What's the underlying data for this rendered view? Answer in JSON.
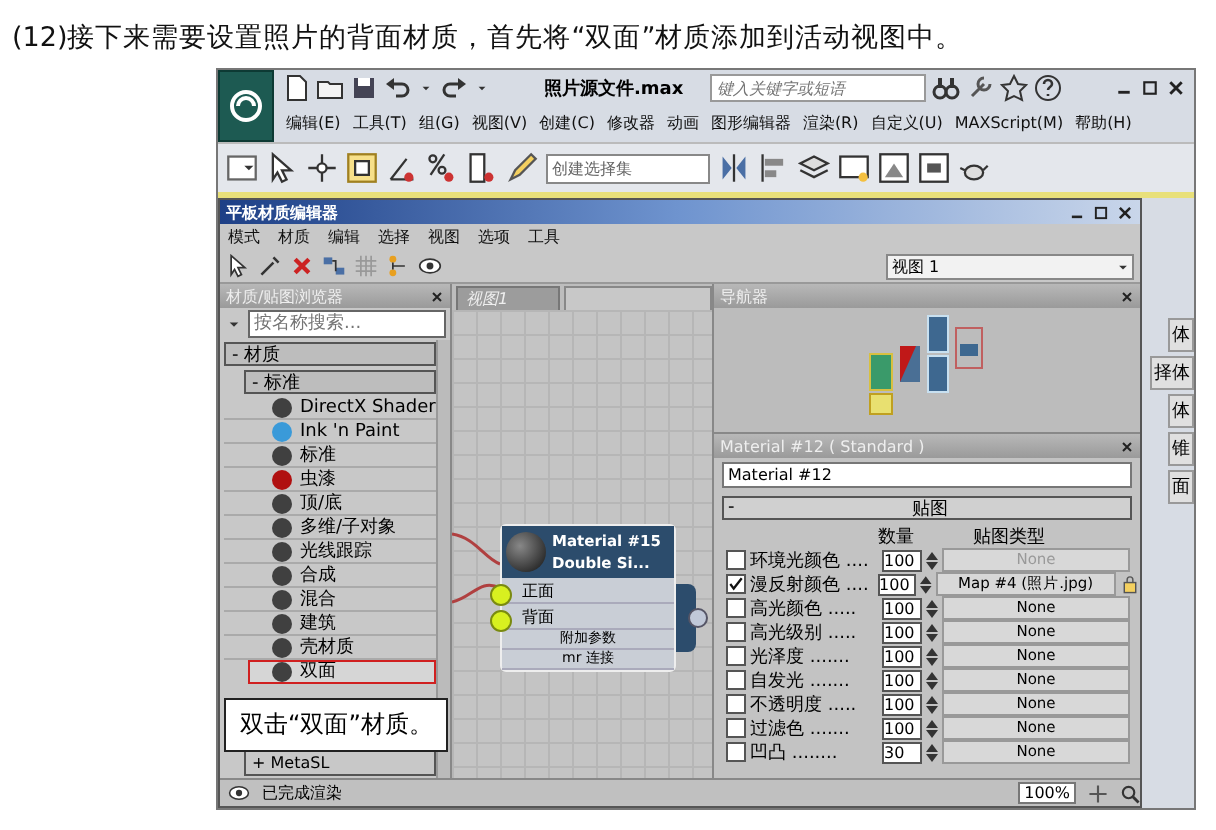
{
  "caption": "(12)接下来需要设置照片的背面材质，首先将“双面”材质添加到活动视图中。",
  "app": {
    "title": "照片源文件.max",
    "search": {
      "placeholder": "键入关键字或短语"
    },
    "menu": [
      "编辑(E)",
      "工具(T)",
      "组(G)",
      "视图(V)",
      "创建(C)",
      "修改器",
      "动画",
      "图形编辑器",
      "渲染(R)",
      "自定义(U)",
      "MAXScript(M)",
      "帮助(H)"
    ],
    "selection_set": "创建选择集",
    "side_labels": [
      "体",
      "择体",
      "体",
      "锥",
      "面"
    ]
  },
  "editor": {
    "title": "平板材质编辑器",
    "menu": [
      "模式",
      "材质",
      "编辑",
      "选择",
      "视图",
      "选项",
      "工具"
    ],
    "view_select": "视图 1",
    "browser": {
      "title": "材质/贴图浏览器",
      "search": {
        "placeholder": "按名称搜索..."
      },
      "group": "- 材质",
      "subgroup": "- 标准",
      "items": [
        {
          "label": "DirectX Shader",
          "color": "#404040",
          "selected": false
        },
        {
          "label": "Ink 'n Paint",
          "color": "#3a9ad9",
          "selected": false
        },
        {
          "label": "标准",
          "color": "#404040",
          "selected": false
        },
        {
          "label": "虫漆",
          "color": "#b01010",
          "selected": false
        },
        {
          "label": "顶/底",
          "color": "#404040",
          "selected": false
        },
        {
          "label": "多维/子对象",
          "color": "#404040",
          "selected": false
        },
        {
          "label": "光线跟踪",
          "color": "#404040",
          "selected": false
        },
        {
          "label": "合成",
          "color": "#404040",
          "selected": false
        },
        {
          "label": "混合",
          "color": "#404040",
          "selected": false
        },
        {
          "label": "建筑",
          "color": "#404040",
          "selected": false
        },
        {
          "label": "壳材质",
          "color": "#404040",
          "selected": false
        },
        {
          "label": "双面",
          "color": "#404040",
          "selected": true
        }
      ],
      "footer": "+ MetaSL"
    },
    "view_tab": "视图1",
    "node": {
      "title": "Material #15",
      "subtitle": "Double Si...",
      "slots": [
        "正面",
        "背面"
      ],
      "rollouts": [
        "附加参数",
        "mr 连接"
      ]
    },
    "navigator": {
      "title": "导航器"
    },
    "material": {
      "header": "Material #12  ( Standard )",
      "name": "Material #12",
      "rollout_sign": "-",
      "rollout": "贴图",
      "columns": [
        "数量",
        "贴图类型"
      ],
      "rows": [
        {
          "label": "环境光颜色 ....",
          "checked": false,
          "amount": "100",
          "map": "None",
          "disabled": true
        },
        {
          "label": "漫反射颜色 ....",
          "checked": true,
          "amount": "100",
          "map": "Map #4 (照片.jpg)",
          "disabled": false
        },
        {
          "label": "高光颜色 .....",
          "checked": false,
          "amount": "100",
          "map": "None",
          "disabled": false
        },
        {
          "label": "高光级别 .....",
          "checked": false,
          "amount": "100",
          "map": "None",
          "disabled": false
        },
        {
          "label": "光泽度 .......",
          "checked": false,
          "amount": "100",
          "map": "None",
          "disabled": false
        },
        {
          "label": "自发光 .......",
          "checked": false,
          "amount": "100",
          "map": "None",
          "disabled": false
        },
        {
          "label": "不透明度 .....",
          "checked": false,
          "amount": "100",
          "map": "None",
          "disabled": false
        },
        {
          "label": "过滤色 .......",
          "checked": false,
          "amount": "100",
          "map": "None",
          "disabled": false
        },
        {
          "label": "凹凸 ........",
          "checked": false,
          "amount": "30",
          "map": "None",
          "disabled": false
        }
      ]
    },
    "status": "已完成渲染",
    "zoom": "100%"
  },
  "callout": "双击“双面”材质。"
}
